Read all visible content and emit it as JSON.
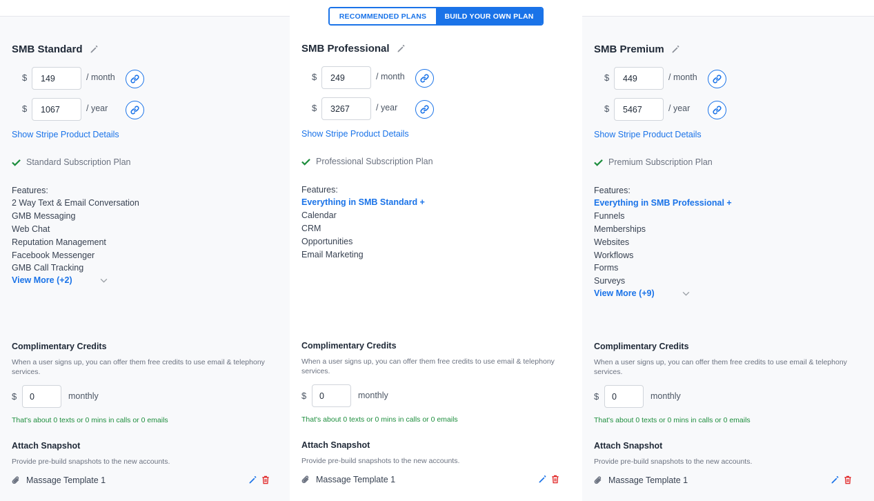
{
  "toggle": {
    "recommended_label": "RECOMMENDED PLANS",
    "build_label": "BUILD YOUR OWN PLAN",
    "active": "build"
  },
  "colors": {
    "accent": "#1a73e8",
    "success": "#1e8e3e",
    "danger": "#e02424"
  },
  "common": {
    "currency": "$",
    "per_month": "/ month",
    "per_year": "/ year",
    "stripe_link": "Show Stripe Product Details",
    "features_label": "Features:",
    "credits_title": "Complimentary Credits",
    "credits_desc": "When a user signs up, you can offer them free credits to use email & telephony services.",
    "monthly_label": "monthly",
    "credits_note": "That's about 0 texts or 0 mins in calls or 0 emails",
    "snapshot_title": "Attach Snapshot",
    "snapshot_desc": "Provide pre-build snapshots to the new accounts."
  },
  "plans": [
    {
      "name": "SMB Standard",
      "monthly_price": "149",
      "yearly_price": "1067",
      "subscription_label": "Standard Subscription Plan",
      "features": [
        "2 Way Text & Email Conversation",
        "GMB Messaging",
        "Web Chat",
        "Reputation Management",
        "Facebook Messenger",
        "GMB Call Tracking"
      ],
      "highlight_first": false,
      "view_more": "View More (+2)",
      "credits_value": "0",
      "snapshot_name": "Massage Template 1"
    },
    {
      "name": "SMB Professional",
      "monthly_price": "249",
      "yearly_price": "3267",
      "subscription_label": "Professional Subscription Plan",
      "features": [
        "Everything in SMB Standard +",
        "Calendar",
        "CRM",
        "Opportunities",
        "Email Marketing"
      ],
      "highlight_first": true,
      "view_more": "",
      "credits_value": "0",
      "snapshot_name": "Massage Template 1"
    },
    {
      "name": "SMB Premium",
      "monthly_price": "449",
      "yearly_price": "5467",
      "subscription_label": "Premium Subscription Plan",
      "features": [
        "Everything in SMB Professional +",
        "Funnels",
        "Memberships",
        "Websites",
        "Workflows",
        "Forms",
        "Surveys"
      ],
      "highlight_first": true,
      "view_more": "View More (+9)",
      "credits_value": "0",
      "snapshot_name": "Massage Template 1"
    }
  ]
}
